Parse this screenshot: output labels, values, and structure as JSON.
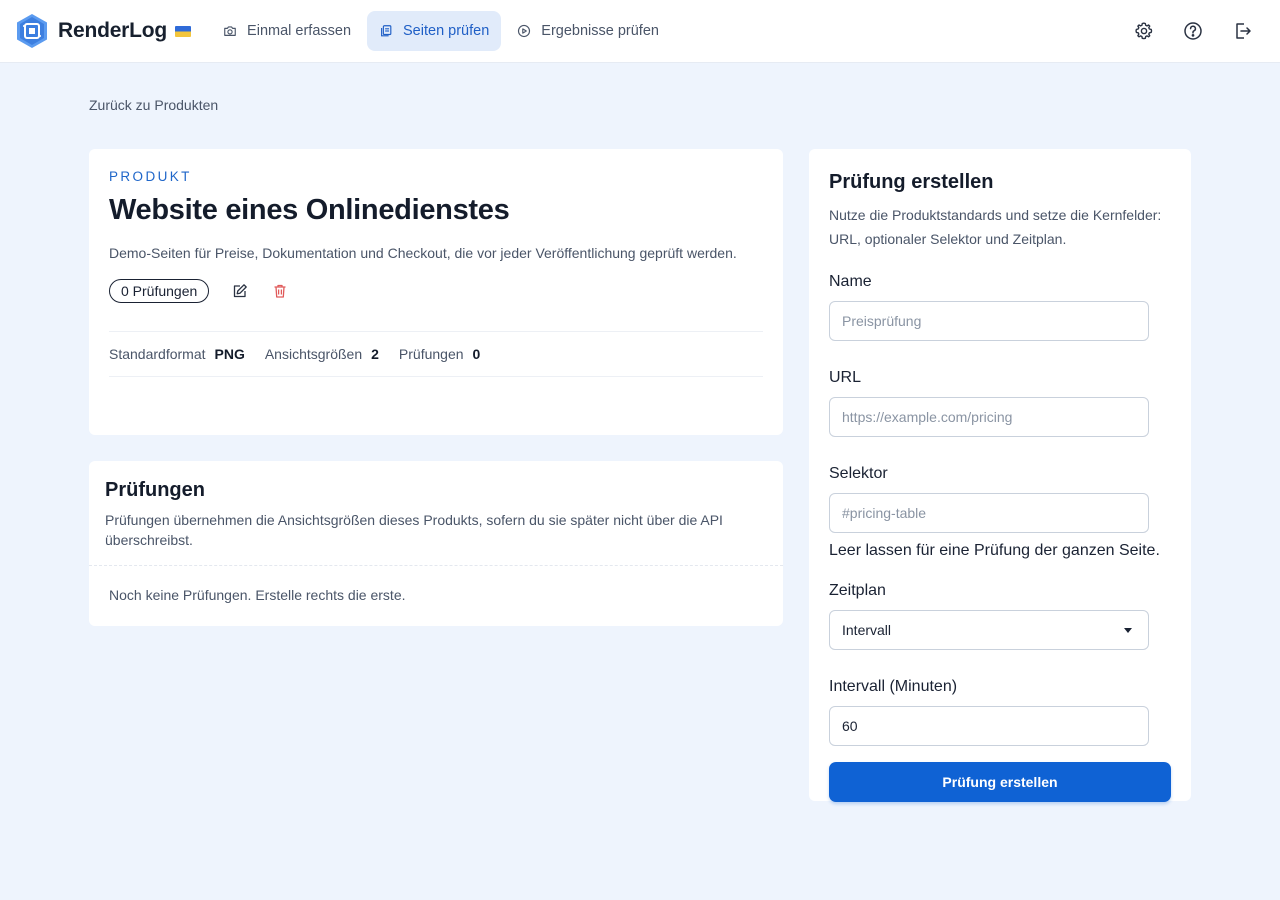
{
  "brand": {
    "name": "RenderLog"
  },
  "nav": {
    "items": [
      {
        "label": "Einmal erfassen",
        "icon": "camera-icon",
        "active": false
      },
      {
        "label": "Seiten prüfen",
        "icon": "copy-pages-icon",
        "active": true
      },
      {
        "label": "Ergebnisse prüfen",
        "icon": "play-circle-icon",
        "active": false
      }
    ]
  },
  "header_actions": {
    "settings_icon": "gear-icon",
    "help_icon": "help-circle-icon",
    "logout_icon": "logout-icon"
  },
  "back_link": "Zurück zu Produkten",
  "product": {
    "eyebrow": "PRODUKT",
    "title": "Website eines Onlinedienstes",
    "description": "Demo-Seiten für Preise, Dokumentation und Checkout, die vor jeder Veröffentlichung geprüft werden.",
    "checks_badge": "0 Prüfungen",
    "meta": [
      {
        "label": "Standardformat",
        "value": "PNG"
      },
      {
        "label": "Ansichtsgrößen",
        "value": "2"
      },
      {
        "label": "Prüfungen",
        "value": "0"
      }
    ]
  },
  "checks": {
    "title": "Prüfungen",
    "description": "Prüfungen übernehmen die Ansichtsgrößen dieses Produkts, sofern du sie später nicht über die API überschreibst.",
    "empty_text": "Noch keine Prüfungen. Erstelle rechts die erste."
  },
  "form": {
    "title": "Prüfung erstellen",
    "description": "Nutze die Produktstandards und setze die Kernfelder: URL, optionaler Selektor und Zeitplan.",
    "name_label": "Name",
    "name_placeholder": "Preisprüfung",
    "url_label": "URL",
    "url_placeholder": "https://example.com/pricing",
    "selector_label": "Selektor",
    "selector_placeholder": "#pricing-table",
    "selector_hint": "Leer lassen für eine Prüfung der ganzen Seite.",
    "schedule_label": "Zeitplan",
    "schedule_value": "Intervall",
    "interval_label": "Intervall (Minuten)",
    "interval_value": "60",
    "submit_label": "Prüfung erstellen"
  },
  "colors": {
    "accent": "#0f62d4",
    "nav_active_bg": "#e1ebfa",
    "page_bg": "#eef4fd",
    "delete": "#e05a5a"
  }
}
